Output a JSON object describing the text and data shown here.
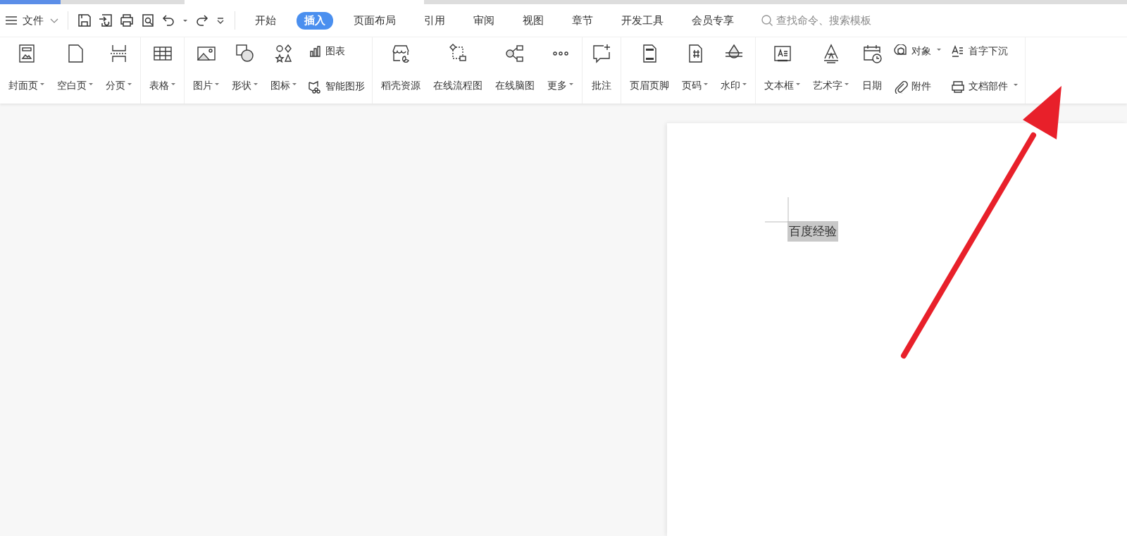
{
  "file_menu": {
    "label": "文件"
  },
  "tabs": [
    {
      "label": "开始",
      "selected": false
    },
    {
      "label": "插入",
      "selected": true
    },
    {
      "label": "页面布局",
      "selected": false
    },
    {
      "label": "引用",
      "selected": false
    },
    {
      "label": "审阅",
      "selected": false
    },
    {
      "label": "视图",
      "selected": false
    },
    {
      "label": "章节",
      "selected": false
    },
    {
      "label": "开发工具",
      "selected": false
    },
    {
      "label": "会员专享",
      "selected": false
    }
  ],
  "search": {
    "placeholder": "查找命令、搜索模板"
  },
  "ribbon": [
    {
      "items": [
        {
          "kind": "large",
          "label": "封面页",
          "dropdown": true
        },
        {
          "kind": "large",
          "label": "空白页",
          "dropdown": true
        },
        {
          "kind": "large",
          "label": "分页",
          "dropdown": true
        }
      ]
    },
    {
      "items": [
        {
          "kind": "large",
          "label": "表格",
          "dropdown": true
        }
      ]
    },
    {
      "items": [
        {
          "kind": "large",
          "label": "图片",
          "dropdown": true
        },
        {
          "kind": "large",
          "label": "形状",
          "dropdown": true
        },
        {
          "kind": "large",
          "label": "图标",
          "dropdown": true
        },
        {
          "kind": "stack",
          "entries": [
            {
              "label": "图表",
              "dropdown": false
            },
            {
              "label": "智能图形",
              "dropdown": false
            }
          ]
        }
      ]
    },
    {
      "items": [
        {
          "kind": "large",
          "label": "稻壳资源",
          "dropdown": false
        },
        {
          "kind": "large",
          "label": "在线流程图",
          "dropdown": false
        },
        {
          "kind": "large",
          "label": "在线脑图",
          "dropdown": false
        },
        {
          "kind": "large",
          "label": "更多",
          "dropdown": true
        }
      ]
    },
    {
      "items": [
        {
          "kind": "large",
          "label": "批注",
          "dropdown": false
        }
      ]
    },
    {
      "items": [
        {
          "kind": "large",
          "label": "页眉页脚",
          "dropdown": false
        },
        {
          "kind": "large",
          "label": "页码",
          "dropdown": true
        },
        {
          "kind": "large",
          "label": "水印",
          "dropdown": true
        }
      ]
    },
    {
      "items": [
        {
          "kind": "large",
          "label": "文本框",
          "dropdown": true
        },
        {
          "kind": "large",
          "label": "艺术字",
          "dropdown": true
        },
        {
          "kind": "large",
          "label": "日期",
          "dropdown": false
        },
        {
          "kind": "stack",
          "entries": [
            {
              "label": "对象",
              "dropdown": true
            },
            {
              "label": "附件",
              "dropdown": false
            }
          ]
        },
        {
          "kind": "stack",
          "entries": [
            {
              "label": "首字下沉",
              "dropdown": false
            },
            {
              "label": "文档部件",
              "dropdown": true
            }
          ]
        }
      ]
    }
  ],
  "document": {
    "text": "百度经验",
    "selected": true
  }
}
